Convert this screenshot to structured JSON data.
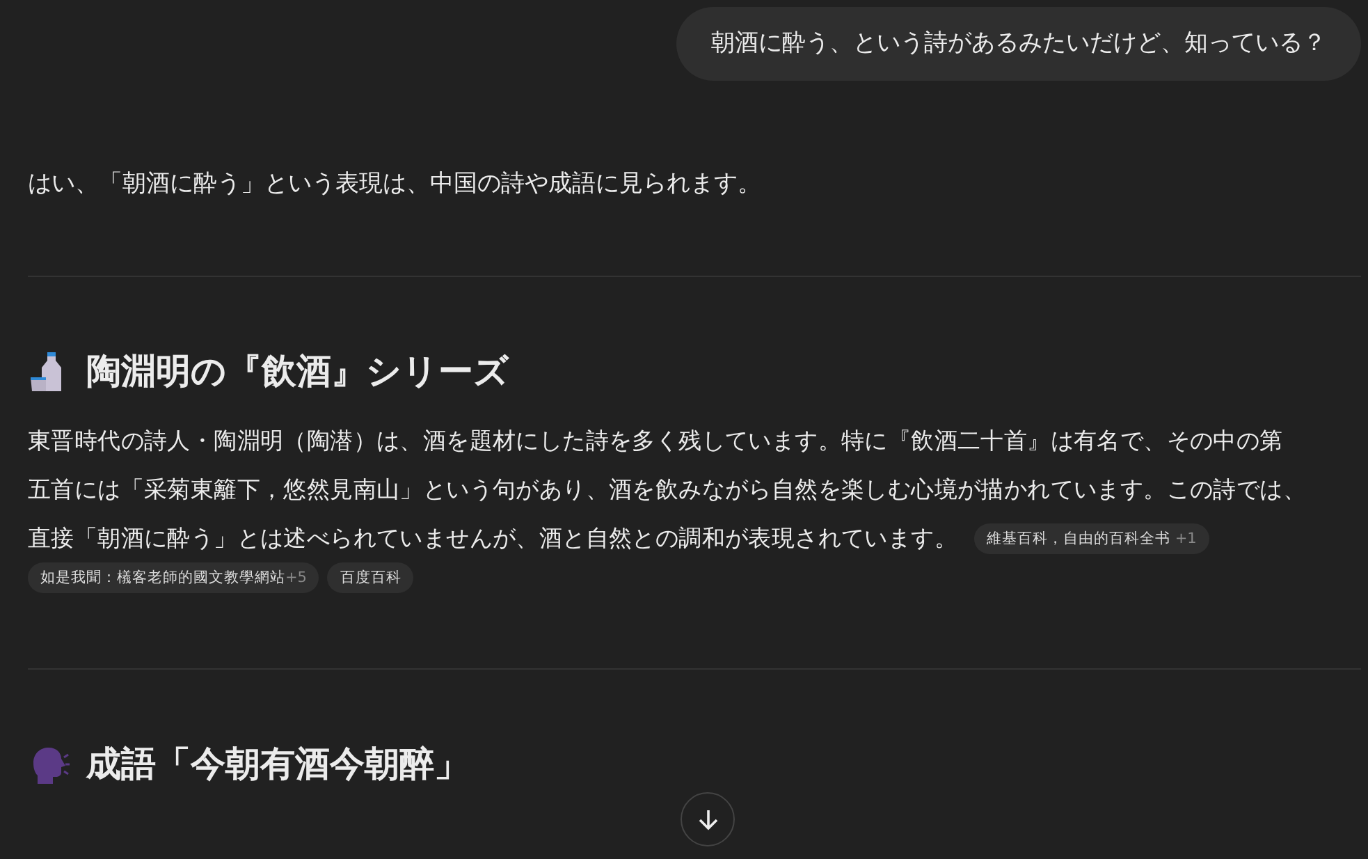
{
  "user_message": "朝酒に酔う、という詩があるみたいだけど、知っている？",
  "answer_intro": "はい、「朝酒に酔う」という表現は、中国の詩や成語に見られます。",
  "sections": [
    {
      "kind": "sake",
      "heading": "陶淵明の『飲酒』シリーズ",
      "paragraph_lines": [
        "東晋時代の詩人・陶淵明（陶潜）は、酒を題材にした詩を多く残しています。特に『飲酒二十首』は有名で、その中の第",
        "五首には「采菊東籬下，悠然見南山」という句があり、酒を飲みながら自然を楽しむ心境が描かれています。この詩では、",
        "直接「朝酒に酔う」とは述べられていませんが、酒と自然との調和が表現されています。"
      ],
      "inline_source": {
        "label": "維基百科，自由的百科全书",
        "extra": "+1"
      },
      "sources": [
        {
          "label": "如是我聞：檥客老師的國文教學網站",
          "extra": "+5"
        },
        {
          "label": "百度百科"
        }
      ]
    },
    {
      "kind": "speaking-head",
      "heading": "成語「今朝有酒今朝醉」"
    }
  ]
}
